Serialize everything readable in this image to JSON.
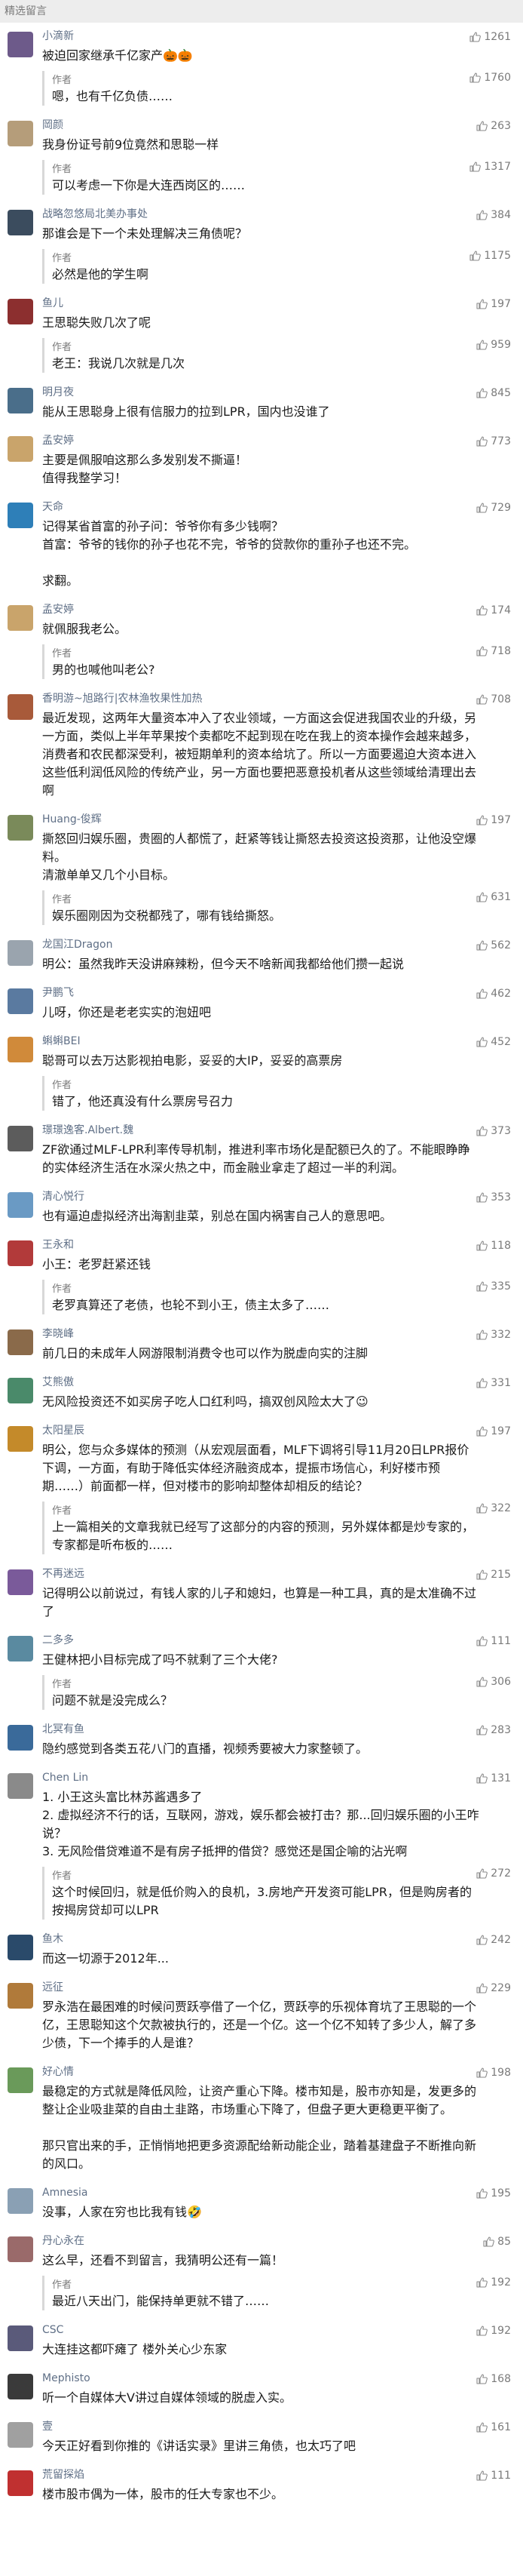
{
  "header": {
    "title": "精选留言"
  },
  "author_label": "作者",
  "comments": [
    {
      "nick": "小滴新",
      "likes": "1261",
      "text": "被迫回家继承千亿家产🎃🎃",
      "reply": {
        "text": "嗯，也有千亿负债……",
        "likes": "1760"
      },
      "avatar_color": "#6d5a8a"
    },
    {
      "nick": "岡颜",
      "likes": "263",
      "text": "我身份证号前9位竟然和思聪一样",
      "reply": {
        "text": "可以考虑一下你是大连西岗区的……",
        "likes": "1317"
      },
      "avatar_color": "#b59d7a"
    },
    {
      "nick": "战略忽悠局北美办事处",
      "likes": "384",
      "text": "那谁会是下一个未处理解决三角债呢？",
      "reply": {
        "text": "必然是他的学生啊",
        "likes": "1175"
      },
      "avatar_color": "#3b4c5e"
    },
    {
      "nick": "鱼儿",
      "likes": "197",
      "text": "王思聪失败几次了呢",
      "reply": {
        "text": "老王：我说几次就是几次",
        "likes": "959"
      },
      "avatar_color": "#8c2f2f"
    },
    {
      "nick": "明月夜",
      "likes": "845",
      "text": "能从王思聪身上很有信服力的拉到LPR，国内也没谁了",
      "reply": null,
      "avatar_color": "#4a6e8a"
    },
    {
      "nick": "孟安婷",
      "likes": "773",
      "text": "主要是佩服咱这那么多发别发不撕逼！\n值得我整学习！",
      "reply": null,
      "avatar_color": "#c9a46b"
    },
    {
      "nick": "天命",
      "likes": "729",
      "text": "记得某省首富的孙子问：爷爷你有多少钱啊？\n首富：爷爷的钱你的孙子也花不完，爷爷的贷款你的重孙子也还不完。\n\n求翻。",
      "reply": null,
      "avatar_color": "#2e7fb8"
    },
    {
      "nick": "孟安婷",
      "likes": "174",
      "text": "就佩服我老公。",
      "reply": {
        "text": "男的也喊他叫老公?",
        "likes": "718"
      },
      "avatar_color": "#c9a46b"
    },
    {
      "nick": "香明游~旭路行|农林渔牧果性加热",
      "likes": "708",
      "text": "最近发现，这两年大量资本冲入了农业领域，一方面这会促进我国农业的升级，另一方面，类似上半年苹果按个卖都吃不起到现在吃在我上的资本操作会越来越多，消费者和农民都深受利，被短期单利的资本给坑了。所以一方面要遏迫大资本进入这些低利润低风险的传统产业，另一方面也要把恶意投机者从这些领域给清理出去啊",
      "reply": null,
      "avatar_color": "#a85a3a"
    },
    {
      "nick": "Huang-俊辉",
      "likes": "197",
      "text": "撕怒回归娱乐圈，贵圈的人都慌了，赶紧等钱让撕怒去投资这投资那，让他没空爆料。\n清澈单单又几个小目标。",
      "reply": {
        "text": "娱乐圈刚因为交税都残了，哪有钱给撕怒。",
        "likes": "631"
      },
      "avatar_color": "#7a8a5a"
    },
    {
      "nick": "龙国江Dragon",
      "likes": "562",
      "text": "明公：虽然我昨天没讲麻辣粉，但今天不啥新闻我都给他们攒一起说",
      "reply": null,
      "avatar_color": "#9aa4ae"
    },
    {
      "nick": "尹鹏飞",
      "likes": "462",
      "text": "儿呀，你还是老老实实的泡妞吧",
      "reply": null,
      "avatar_color": "#5a7aa0"
    },
    {
      "nick": "蝌蝌BEI",
      "likes": "452",
      "text": "聪哥可以去万达影视拍电影，妥妥的大IP，妥妥的高票房",
      "reply": {
        "text": "错了，他还真没有什么票房号召力",
        "likes": ""
      },
      "avatar_color": "#d08a3a"
    },
    {
      "nick": "璟璟逸客.Albert.魏",
      "likes": "373",
      "text": "ZF欲通过MLF-LPR利率传导机制，推进利率市场化是配额已久的了。不能眼睁睁的实体经济生活在水深火热之中，而金融业拿走了超过一半的利润。",
      "reply": null,
      "avatar_color": "#5c5c5c"
    },
    {
      "nick": "清心悦行",
      "likes": "353",
      "text": "也有逼迫虚拟经济出海割韭菜，别总在国内祸害自己人的意思吧。",
      "reply": null,
      "avatar_color": "#6a9ac4"
    },
    {
      "nick": "王永和",
      "likes": "118",
      "text": "小王：老罗赶紧还钱",
      "reply": {
        "text": "老罗真算还了老债，也轮不到小王，债主太多了……",
        "likes": "335"
      },
      "avatar_color": "#b23a3a"
    },
    {
      "nick": "李晓峰",
      "likes": "332",
      "text": "前几日的未成年人网游限制消费令也可以作为脱虚向实的注脚",
      "reply": null,
      "avatar_color": "#8a6a4a"
    },
    {
      "nick": "艾熊傲",
      "likes": "331",
      "text": "无风险投资还不如买房子吃人口红利吗，搞双创风险太大了😉",
      "reply": null,
      "avatar_color": "#4a8a6a"
    },
    {
      "nick": "太阳星辰",
      "likes": "197",
      "text": "明公，您与众多媒体的预测（从宏观层面看，MLF下调将引导11月20日LPR报价下调，一方面，有助于降低实体经济融资成本，提振市场信心，利好楼市预期……）前面都一样，但对楼市的影响却整体却相反的结论？",
      "reply": {
        "text": "上一篇相关的文章我就已经写了这部分的内容的预测，另外媒体都是炒专家的，专家都是听布板的……",
        "likes": "322"
      },
      "avatar_color": "#c48a2a"
    },
    {
      "nick": "不再迷远",
      "likes": "215",
      "text": "记得明公以前说过，有钱人家的儿子和媳妇，也算是一种工具，真的是太准确不过了",
      "reply": null,
      "avatar_color": "#7a5a9a"
    },
    {
      "nick": "二多多",
      "likes": "111",
      "text": "王健林把小目标完成了吗不就剩了三个大佬?",
      "reply": {
        "text": "问题不就是没完成么？",
        "likes": "306"
      },
      "avatar_color": "#5a8aa0"
    },
    {
      "nick": "北冥有鱼",
      "likes": "283",
      "text": "隐约感觉到各类五花八门的直播，视频秀要被大力家整顿了。",
      "reply": null,
      "avatar_color": "#3a6a9a"
    },
    {
      "nick": "Chen Lin",
      "likes": "131",
      "text": "1. 小王这头富比林苏酱遇多了\n2. 虚拟经济不行的话，互联网，游戏，娱乐都会被打击？那...回归娱乐圈的小王咋说？\n3. 无风险借贷难道不是有房子抵押的借贷？感觉还是国企喻的沾光啊",
      "reply": {
        "text": "这个时候回归，就是低价购入的良机，3.房地产开发资可能LPR，但是购房者的按揭房贷却可以LPR",
        "likes": "272"
      },
      "avatar_color": "#8a8a8a"
    },
    {
      "nick": "鱼木",
      "likes": "242",
      "text": "而这一切源于2012年...",
      "reply": null,
      "avatar_color": "#2a4a6a"
    },
    {
      "nick": "远征",
      "likes": "229",
      "text": "罗永浩在最困难的时候问贾跃亭借了一个亿，贾跃亭的乐视体育坑了王思聪的一个亿，王思聪知这个欠款被执行的，还是一个亿。这一个亿不知转了多少人，解了多少债，下一个捧手的人是谁？",
      "reply": null,
      "avatar_color": "#b07a3a"
    },
    {
      "nick": "好心情",
      "likes": "198",
      "text": "最稳定的方式就是降低风险，让资产重心下降。楼市知是，股市亦知是，发更多的整让企业吸韭菜的自由土韭路，市场重心下降了，但盘子更大更稳更平衡了。\n\n那只官出来的手，正悄悄地把更多资源配给新动能企业，踏着基建盘子不断推向新的风口。",
      "reply": null,
      "avatar_color": "#6a9a5a"
    },
    {
      "nick": "Amnesia",
      "likes": "195",
      "text": "没事，人家在穷也比我有钱🤣",
      "reply": null,
      "avatar_color": "#8aa0b4"
    },
    {
      "nick": "丹心永在",
      "likes": "85",
      "text": "这么早，还看不到留言，我猜明公还有一篇！",
      "reply": {
        "text": "最近八天出门，能保持单更就不错了……",
        "likes": "192"
      },
      "avatar_color": "#9a6a6a"
    },
    {
      "nick": "CSC",
      "likes": "192",
      "text": "大连挂这都吓瘫了 楼外关心少东家",
      "reply": null,
      "avatar_color": "#5a5a7a"
    },
    {
      "nick": "Mephisto",
      "likes": "168",
      "text": "听一个自媒体大V讲过自媒体领域的脱虚入实。",
      "reply": null,
      "avatar_color": "#3a3a3a"
    },
    {
      "nick": "壹",
      "likes": "161",
      "text": "今天正好看到你推的《讲话实录》里讲三角债，也太巧了吧",
      "reply": null,
      "avatar_color": "#a0a0a0"
    },
    {
      "nick": "荒留探焰",
      "likes": "111",
      "text": "楼市股市偶为一体，股市的任大专家也不少。",
      "reply": null,
      "avatar_color": "#c03030"
    }
  ]
}
